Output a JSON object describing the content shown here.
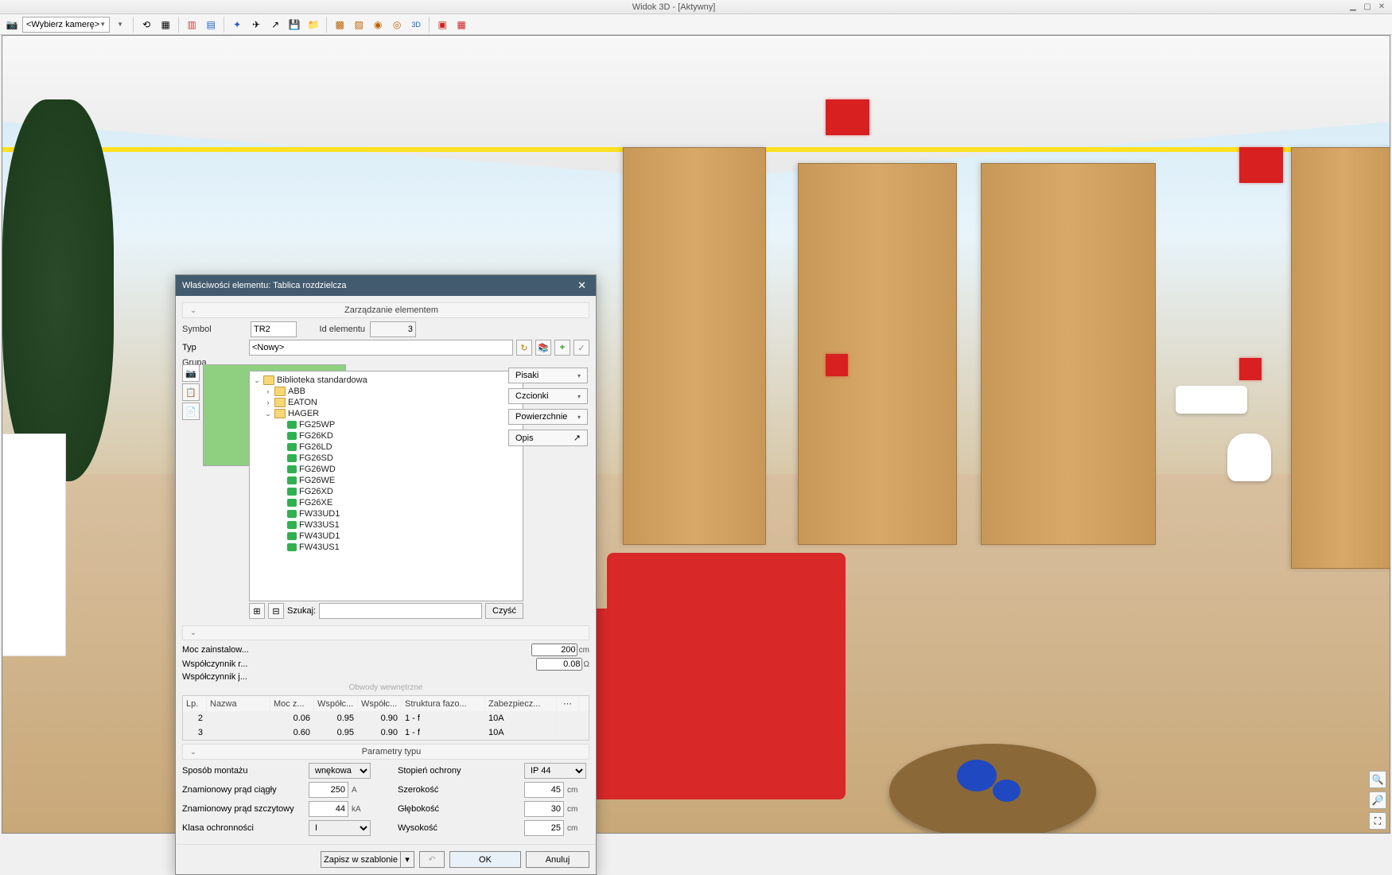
{
  "window": {
    "title": "Widok 3D - [Aktywny]"
  },
  "toolbar": {
    "camera_placeholder": "<Wybierz kamerę>"
  },
  "dialog": {
    "title": "Właściwości elementu: Tablica rozdzielcza",
    "sections": {
      "manage": "Zarządzanie elementem",
      "circuits": "Obwody wewnętrzne",
      "type_params": "Parametry typu"
    },
    "labels": {
      "symbol": "Symbol",
      "id": "Id elementu",
      "type": "Typ",
      "group": "Grupa",
      "search": "Szukaj:",
      "moc": "Moc zainstalow...",
      "wspk": "Współczynnik r...",
      "wspj": "Współczynnik j..."
    },
    "values": {
      "symbol": "TR2",
      "id": "3",
      "type": "<Nowy>",
      "height_val": "200",
      "height_unit": "cm",
      "imp_val": "0.08",
      "imp_unit": "Ω"
    },
    "tree": {
      "root": "Biblioteka standardowa",
      "brands": [
        "ABB",
        "EATON",
        "HAGER"
      ],
      "hager_items": [
        "FG25WP",
        "FG26KD",
        "FG26LD",
        "FG26SD",
        "FG26WD",
        "FG26WE",
        "FG26XD",
        "FG26XE",
        "FW33UD1",
        "FW33US1",
        "FW43UD1",
        "FW43US1"
      ]
    },
    "search_clear": "Czyść",
    "side_buttons": [
      "Pisaki",
      "Czcionki",
      "Powierzchnie",
      "Opis"
    ],
    "grid": {
      "headers": [
        "Lp.",
        "Nazwa",
        "Moc z...",
        "Współc...",
        "Współc...",
        "Struktura fazo...",
        "Zabezpiecz..."
      ],
      "rows": [
        {
          "lp": "2",
          "nazwa": "",
          "moc": "0.06",
          "w1": "0.95",
          "w2": "0.90",
          "faz": "1 - f",
          "zab": "10A"
        },
        {
          "lp": "3",
          "nazwa": "",
          "moc": "0.60",
          "w1": "0.95",
          "w2": "0.90",
          "faz": "1 - f",
          "zab": "10A"
        }
      ]
    },
    "params_left": [
      {
        "label": "Sposób montażu",
        "type": "select",
        "value": "wnękowa"
      },
      {
        "label": "Znamionowy prąd ciągły",
        "type": "num",
        "value": "250",
        "unit": "A"
      },
      {
        "label": "Znamionowy prąd szczytowy",
        "type": "num",
        "value": "44",
        "unit": "kA"
      },
      {
        "label": "Klasa ochronności",
        "type": "select",
        "value": "I"
      }
    ],
    "params_right": [
      {
        "label": "Stopień ochrony",
        "type": "select",
        "value": "IP 44"
      },
      {
        "label": "Szerokość",
        "type": "num",
        "value": "45",
        "unit": "cm"
      },
      {
        "label": "Głębokość",
        "type": "num",
        "value": "30",
        "unit": "cm"
      },
      {
        "label": "Wysokość",
        "type": "num",
        "value": "25",
        "unit": "cm"
      }
    ],
    "footer": {
      "save_template": "Zapisz w szablonie",
      "ok": "OK",
      "cancel": "Anuluj"
    }
  }
}
